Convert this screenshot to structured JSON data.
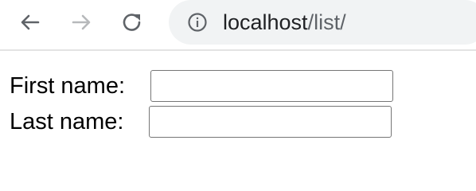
{
  "browser": {
    "nav": {
      "back_icon": "arrow-left-icon",
      "forward_icon": "arrow-right-icon",
      "reload_icon": "reload-icon"
    },
    "address_bar": {
      "info_icon": "info-icon",
      "host": "localhost",
      "path": "/list/"
    }
  },
  "form": {
    "first_name": {
      "label": "First name:",
      "value": ""
    },
    "last_name": {
      "label": "Last name:",
      "value": ""
    }
  },
  "colors": {
    "omnibox_bg": "#f1f3f4",
    "icon_active": "#5f6368",
    "icon_disabled": "#b7b9bb",
    "input_border": "#767676"
  }
}
